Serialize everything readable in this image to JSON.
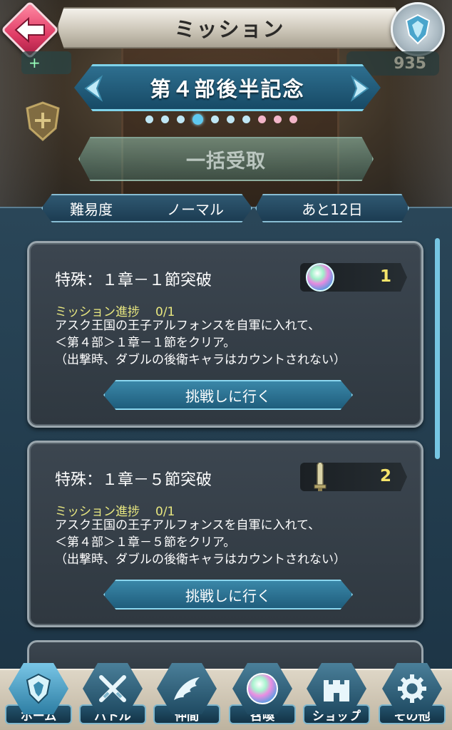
{
  "header": {
    "title": "ミッション",
    "stat_left": "+",
    "stat_right": "935"
  },
  "event": {
    "title": "第４部後半記念",
    "page_count": 10,
    "active_page": 4
  },
  "claim_all_label": "一括受取",
  "filter": {
    "difficulty_label": "難易度",
    "difficulty_value": "ノーマル",
    "days_left": "あと12日"
  },
  "missions": [
    {
      "title": "特殊：１章－１節突破",
      "reward_icon": "orb-icon",
      "reward_count": "1",
      "progress_label": "ミッション進捗",
      "progress_value": "0/1",
      "progress_fraction": 0,
      "desc_line1": "アスク王国の王子アルフォンスを自軍に入れて、",
      "desc_line2": "＜第４部＞１章－１節をクリア。",
      "desc_line3": "（出撃時、ダブルの後衛キャラはカウントされない）",
      "button_label": "挑戦しに行く"
    },
    {
      "title": "特殊：１章－５節突破",
      "reward_icon": "sword-token-icon",
      "reward_count": "2",
      "progress_label": "ミッション進捗",
      "progress_value": "0/1",
      "progress_fraction": 0,
      "desc_line1": "アスク王国の王子アルフォンスを自軍に入れて、",
      "desc_line2": "＜第４部＞１章－５節をクリア。",
      "desc_line3": "（出撃時、ダブルの後衛キャラはカウントされない）",
      "button_label": "挑戦しに行く"
    }
  ],
  "nav": [
    {
      "label": "ホーム",
      "icon": "home-crest-icon",
      "active": true
    },
    {
      "label": "バトル",
      "icon": "crossed-swords-icon",
      "active": false
    },
    {
      "label": "仲間",
      "icon": "wing-icon",
      "active": false
    },
    {
      "label": "召喚",
      "icon": "summon-orb-icon",
      "active": false
    },
    {
      "label": "ショップ",
      "icon": "castle-icon",
      "active": false
    },
    {
      "label": "その他",
      "icon": "gear-icon",
      "active": false
    }
  ],
  "colors": {
    "accent": "#7fd3ea",
    "progress_text": "#e9e880",
    "reward_count": "#f5e46a",
    "back_button": "#e03c66"
  }
}
